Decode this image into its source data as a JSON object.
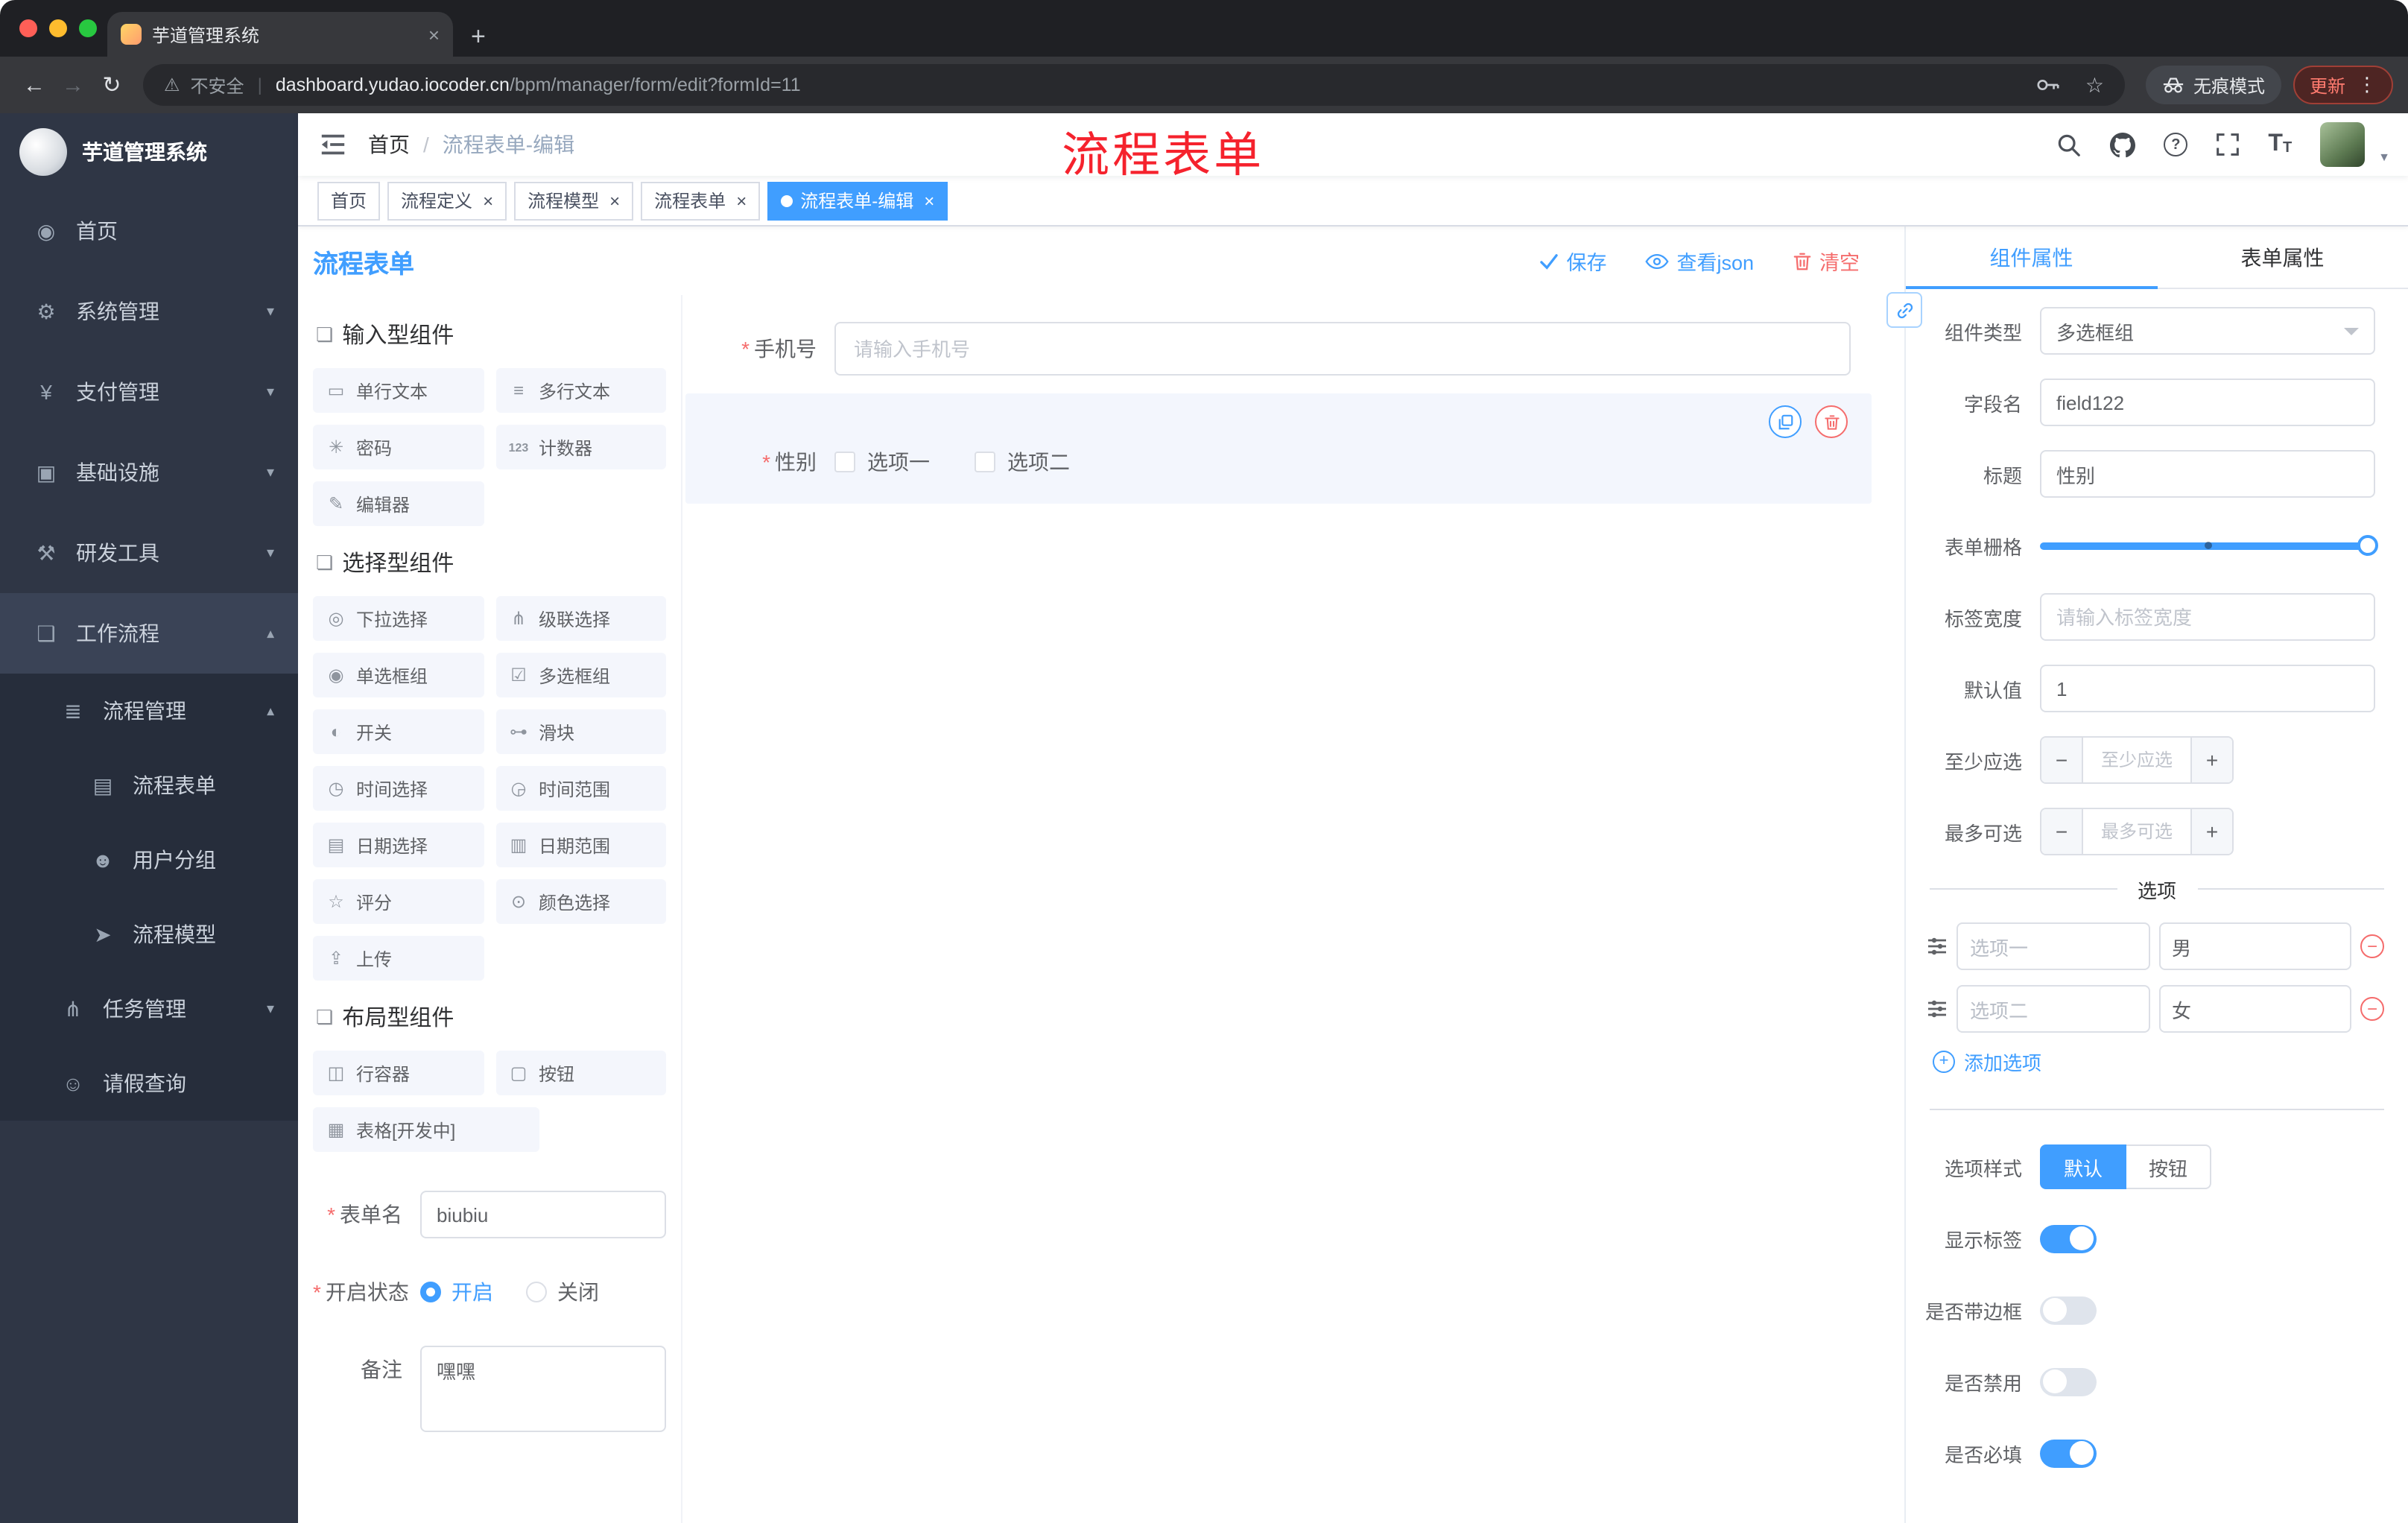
{
  "browser": {
    "tab_title": "芋道管理系统",
    "security_label": "不安全",
    "url_domain": "dashboard.yudao.iocoder.cn",
    "url_path": "/bpm/manager/form/edit?formId=11",
    "incognito_label": "无痕模式",
    "update_label": "更新"
  },
  "sidebar": {
    "logo_text": "芋道管理系统",
    "menu": [
      {
        "name": "home",
        "label": "首页",
        "icon": "dashboard-icon",
        "level": 1
      },
      {
        "name": "system",
        "label": "系统管理",
        "icon": "gear-icon",
        "level": 1,
        "arrow": "down"
      },
      {
        "name": "payment",
        "label": "支付管理",
        "icon": "yen-icon",
        "level": 1,
        "arrow": "down"
      },
      {
        "name": "infrastructure",
        "label": "基础设施",
        "icon": "infra-icon",
        "level": 1,
        "arrow": "down"
      },
      {
        "name": "devtools",
        "label": "研发工具",
        "icon": "tools-icon",
        "level": 1,
        "arrow": "down"
      },
      {
        "name": "workflow",
        "label": "工作流程",
        "icon": "workflow-icon",
        "level": 1,
        "arrow": "up",
        "open": true
      },
      {
        "name": "process-manage",
        "label": "流程管理",
        "icon": "process-manage-icon",
        "level": 2,
        "arrow": "up",
        "open": true
      },
      {
        "name": "process-form",
        "label": "流程表单",
        "icon": "form-icon",
        "level": 3
      },
      {
        "name": "user-group",
        "label": "用户分组",
        "icon": "user-group-icon",
        "level": 3
      },
      {
        "name": "process-model",
        "label": "流程模型",
        "icon": "model-icon",
        "level": 3
      },
      {
        "name": "task-manage",
        "label": "任务管理",
        "icon": "task-icon",
        "level": 2,
        "arrow": "down"
      },
      {
        "name": "leave-query",
        "label": "请假查询",
        "icon": "leave-user-icon",
        "level": 2
      }
    ]
  },
  "navbar": {
    "breadcrumb_root": "首页",
    "breadcrumb_current": "流程表单-编辑",
    "annotation": "流程表单"
  },
  "tags": [
    {
      "label": "首页",
      "closable": false,
      "active": false
    },
    {
      "label": "流程定义",
      "closable": true,
      "active": false
    },
    {
      "label": "流程模型",
      "closable": true,
      "active": false
    },
    {
      "label": "流程表单",
      "closable": true,
      "active": false
    },
    {
      "label": "流程表单-编辑",
      "closable": true,
      "active": true
    }
  ],
  "designer": {
    "title": "流程表单",
    "save_label": "保存",
    "view_json_label": "查看json",
    "clear_label": "清空",
    "palette_sections": [
      {
        "title": "输入型组件",
        "items": [
          {
            "label": "单行文本",
            "icon": "single-line-text-icon"
          },
          {
            "label": "多行文本",
            "icon": "multi-line-text-icon"
          },
          {
            "label": "密码",
            "icon": "password-icon"
          },
          {
            "label": "计数器",
            "icon": "counter-icon"
          },
          {
            "label": "编辑器",
            "icon": "editor-icon"
          }
        ]
      },
      {
        "title": "选择型组件",
        "items": [
          {
            "label": "下拉选择",
            "icon": "select-icon"
          },
          {
            "label": "级联选择",
            "icon": "cascader-icon"
          },
          {
            "label": "单选框组",
            "icon": "radio-group-icon"
          },
          {
            "label": "多选框组",
            "icon": "checkbox-group-icon"
          },
          {
            "label": "开关",
            "icon": "switch-icon"
          },
          {
            "label": "滑块",
            "icon": "slider-icon"
          },
          {
            "label": "时间选择",
            "icon": "time-icon"
          },
          {
            "label": "时间范围",
            "icon": "time-range-icon"
          },
          {
            "label": "日期选择",
            "icon": "date-icon"
          },
          {
            "label": "日期范围",
            "icon": "date-range-icon"
          },
          {
            "label": "评分",
            "icon": "rate-icon"
          },
          {
            "label": "颜色选择",
            "icon": "color-icon"
          },
          {
            "label": "上传",
            "icon": "upload-icon"
          }
        ]
      },
      {
        "title": "布局型组件",
        "items": [
          {
            "label": "行容器",
            "icon": "row-container-icon"
          },
          {
            "label": "按钮",
            "icon": "button-icon"
          },
          {
            "label": "表格[开发中]",
            "icon": "table-icon",
            "wide": true
          }
        ]
      }
    ],
    "meta": {
      "name_label": "表单名",
      "name_value": "biubiu",
      "status_label": "开启状态",
      "status_on": "开启",
      "status_off": "关闭",
      "remark_label": "备注",
      "remark_value": "嘿嘿"
    },
    "canvas": {
      "phone_label": "手机号",
      "phone_placeholder": "请输入手机号",
      "gender_label": "性别",
      "gender_options": [
        "选项一",
        "选项二"
      ]
    }
  },
  "properties": {
    "tab_component": "组件属性",
    "tab_form": "表单属性",
    "component_type_label": "组件类型",
    "component_type_value": "多选框组",
    "field_name_label": "字段名",
    "field_name_value": "field122",
    "title_label": "标题",
    "title_value": "性别",
    "grid_label": "表单栅格",
    "label_width_label": "标签宽度",
    "label_width_placeholder": "请输入标签宽度",
    "default_label": "默认值",
    "default_value": "1",
    "min_label": "至少应选",
    "min_placeholder": "至少应选",
    "max_label": "最多可选",
    "max_placeholder": "最多可选",
    "options_title": "选项",
    "options": [
      {
        "label": "选项一",
        "value": "男"
      },
      {
        "label": "选项二",
        "value": "女"
      }
    ],
    "add_option_label": "添加选项",
    "option_style_label": "选项样式",
    "style_default": "默认",
    "style_button": "按钮",
    "switches": [
      {
        "label": "显示标签",
        "on": true
      },
      {
        "label": "是否带边框",
        "on": false
      },
      {
        "label": "是否禁用",
        "on": false
      },
      {
        "label": "是否必填",
        "on": true
      }
    ],
    "accent_color": "#409eff",
    "danger_color": "#f56c6c"
  }
}
